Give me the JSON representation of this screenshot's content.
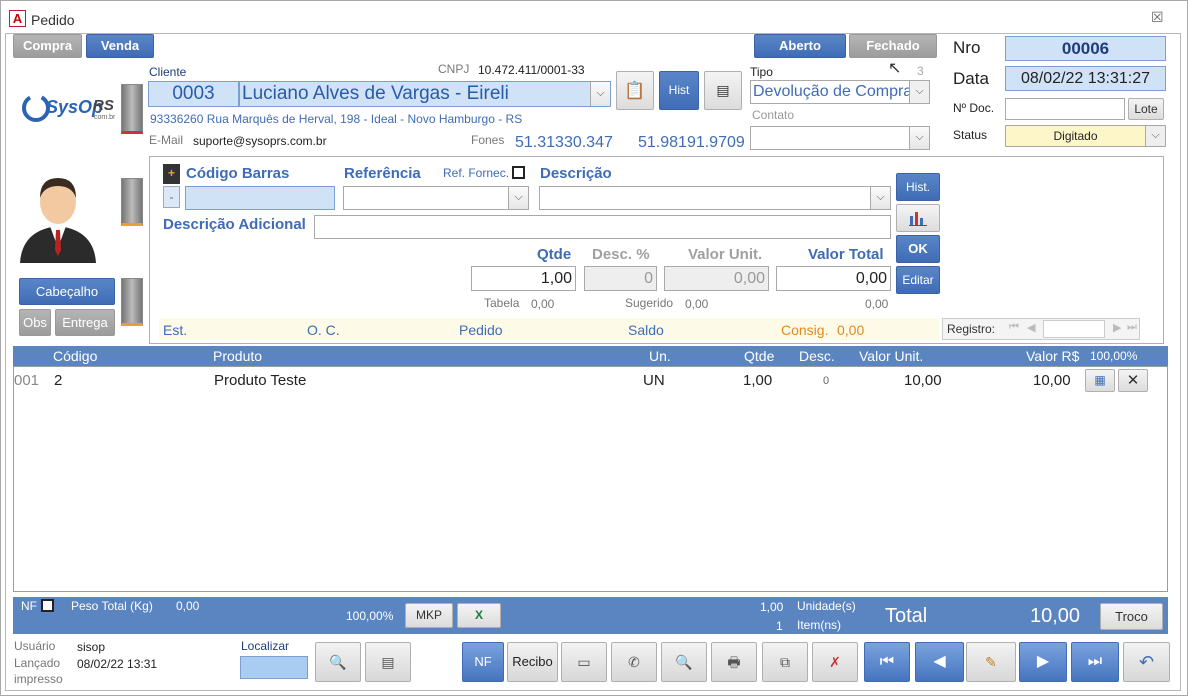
{
  "window": {
    "title": "Pedido",
    "close": "☒"
  },
  "tabs": {
    "compra": "Compra",
    "venda": "Venda",
    "aberto": "Aberto",
    "fechado": "Fechado"
  },
  "header": {
    "nro_label": "Nro",
    "nro": "00006",
    "data_label": "Data",
    "data": "08/02/22 13:31:27",
    "ndoc_label": "Nº Doc.",
    "ndoc": "",
    "lote": "Lote",
    "status_label": "Status",
    "status": "Digitado"
  },
  "cliente": {
    "label": "Cliente",
    "cnpj_label": "CNPJ",
    "cnpj": "10.472.411/0001-33",
    "code": "0003",
    "name": "Luciano Alves de Vargas - Eireli",
    "address": "93336260 Rua Marquês de Herval, 198 - Ideal - Novo Hamburgo - RS",
    "email_label": "E-Mail",
    "email": "suporte@sysoprs.com.br",
    "fones_label": "Fones",
    "fone1": "51.31330.347",
    "fone2": "51.98191.9709",
    "hist": "Hist"
  },
  "tipo": {
    "label": "Tipo",
    "count": "3",
    "value": "Devolução de Compra",
    "contato_label": "Contato",
    "contato": ""
  },
  "logo": {
    "text": "SysOp RS",
    "sub": "com.br"
  },
  "left": {
    "cabecalho": "Cabeçalho",
    "obs": "Obs",
    "entrega": "Entrega"
  },
  "item": {
    "plus": "+",
    "minus": "-",
    "codigo_barras": "Código Barras",
    "referencia": "Referência",
    "ref_fornec": "Ref. Fornec.",
    "descricao": "Descrição",
    "desc_adicional": "Descrição Adicional",
    "qtde_label": "Qtde",
    "qtde": "1,00",
    "desc_pct_label": "Desc. %",
    "desc_pct": "0",
    "valor_unit_label": "Valor Unit.",
    "valor_unit": "0,00",
    "valor_total_label": "Valor Total",
    "valor_total": "0,00",
    "tabela_label": "Tabela",
    "tabela": "0,00",
    "sugerido_label": "Sugerido",
    "sugerido": "0,00",
    "zero_right": "0,00",
    "hist": "Hist.",
    "ok": "OK",
    "editar": "Editar"
  },
  "estoque": {
    "est": "Est.",
    "oc": "O. C.",
    "pedido": "Pedido",
    "saldo": "Saldo",
    "consig": "Consig.",
    "consig_val": "0,00",
    "registro": "Registro:"
  },
  "grid": {
    "headers": {
      "codigo": "Código",
      "produto": "Produto",
      "un": "Un.",
      "qtde": "Qtde",
      "desc": "Desc.",
      "valor_unit": "Valor Unit.",
      "valor": "Valor R$",
      "pct": "100,00%"
    },
    "rows": [
      {
        "seq": "001",
        "codigo": "2",
        "produto": "Produto Teste",
        "un": "UN",
        "qtde": "1,00",
        "desc": "0",
        "valor_unit": "10,00",
        "valor": "10,00"
      }
    ]
  },
  "footer": {
    "nf": "NF",
    "peso_label": "Peso Total (Kg)",
    "peso": "0,00",
    "pct": "100,00%",
    "mkp": "MKP",
    "excel": "X",
    "unidades_val": "1,00",
    "unidades": "Unidade(s)",
    "itens_val": "1",
    "itens": "Item(ns)",
    "total_label": "Total",
    "total": "10,00",
    "troco": "Troco"
  },
  "bottom": {
    "usuario_label": "Usuário",
    "usuario": "sisop",
    "lancado_label": "Lançado",
    "lancado": "08/02/22 13:31",
    "impresso_label": "impresso",
    "localizar": "Localizar",
    "nf": "NF",
    "recibo": "Recibo"
  }
}
